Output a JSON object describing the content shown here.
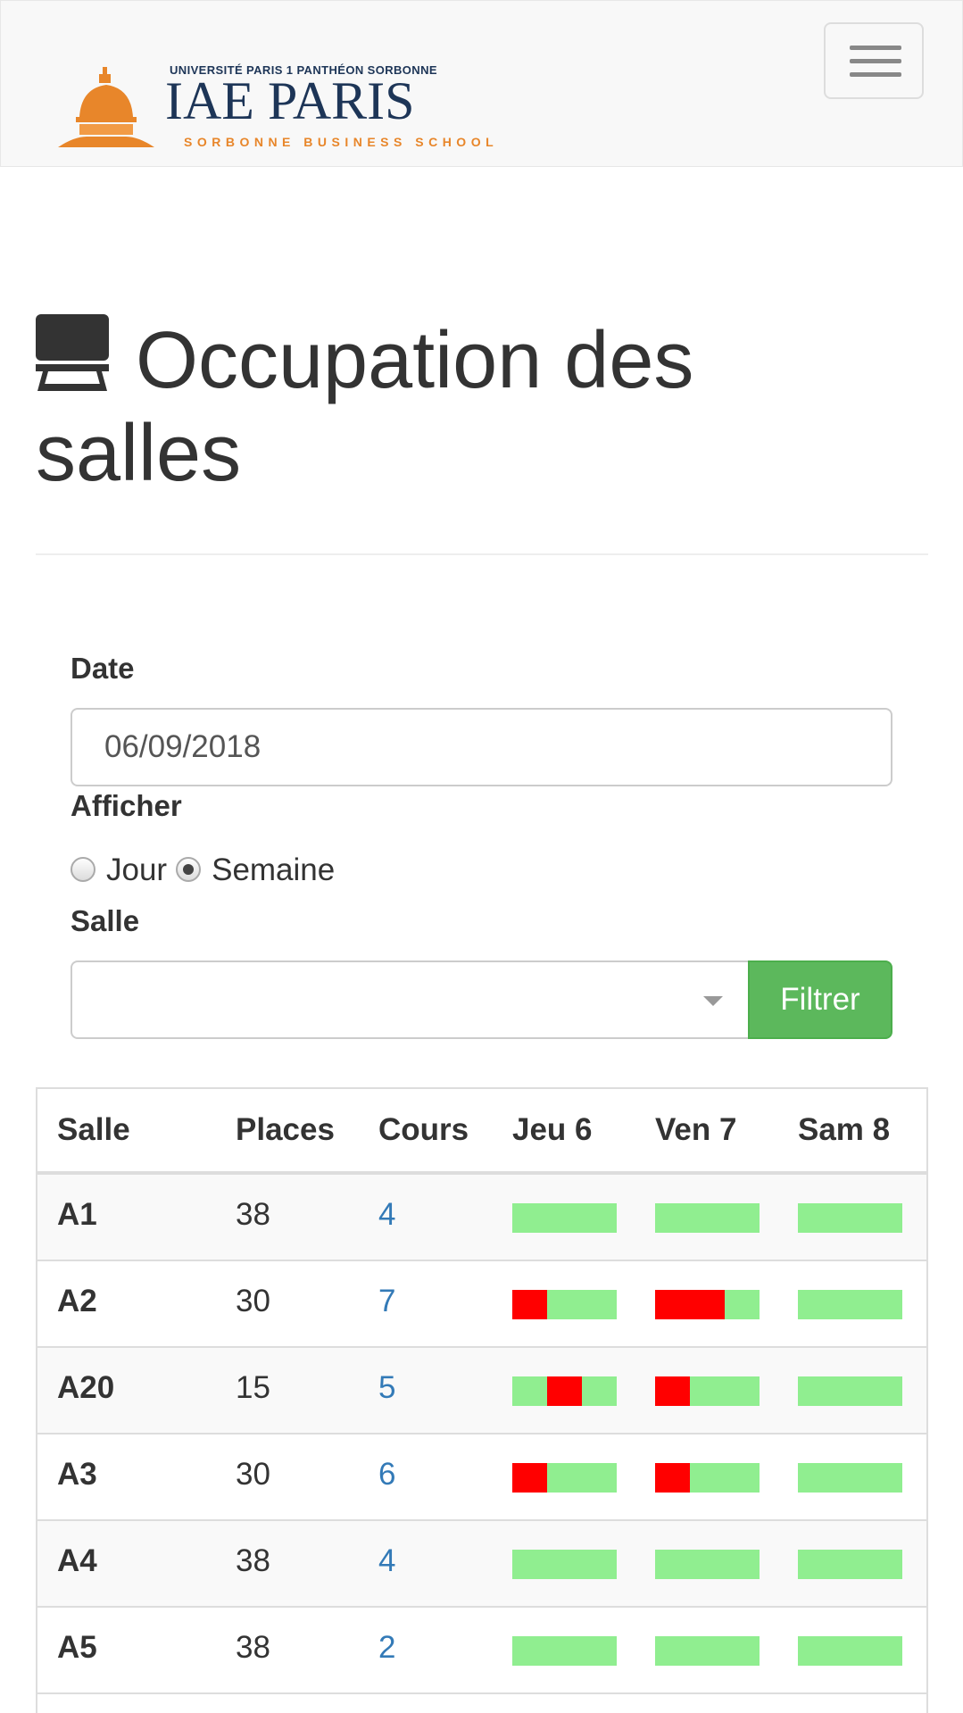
{
  "header": {
    "logo_small_text": "UNIVERSITÉ PARIS 1 PANTHÉON SORBONNE",
    "logo_main_text": "IAE PARIS",
    "logo_sub_text": "SORBONNE BUSINESS SCHOOL",
    "menu_icon": "hamburger-menu-icon"
  },
  "page": {
    "title": "Occupation des salles",
    "title_icon": "classroom-desk-icon"
  },
  "form": {
    "date_label": "Date",
    "date_value": "06/09/2018",
    "afficher_label": "Afficher",
    "options": [
      {
        "label": "Jour",
        "checked": false
      },
      {
        "label": "Semaine",
        "checked": true
      }
    ],
    "salle_label": "Salle",
    "salle_value": "",
    "filter_button": "Filtrer"
  },
  "table": {
    "headers": [
      "Salle",
      "Places",
      "Cours",
      "Jeu 6",
      "Ven 7",
      "Sam 8"
    ],
    "rows": [
      {
        "salle": "A1",
        "places": "38",
        "cours": "4",
        "occupancy": [
          [
            0,
            0,
            0
          ],
          [
            0,
            0,
            0
          ],
          [
            0,
            0,
            0
          ]
        ]
      },
      {
        "salle": "A2",
        "places": "30",
        "cours": "7",
        "occupancy": [
          [
            1,
            0,
            0
          ],
          [
            1,
            1,
            0
          ],
          [
            0,
            0,
            0
          ]
        ]
      },
      {
        "salle": "A20",
        "places": "15",
        "cours": "5",
        "occupancy": [
          [
            0,
            1,
            0
          ],
          [
            1,
            0,
            0
          ],
          [
            0,
            0,
            0
          ]
        ]
      },
      {
        "salle": "A3",
        "places": "30",
        "cours": "6",
        "occupancy": [
          [
            1,
            0,
            0
          ],
          [
            1,
            0,
            0
          ],
          [
            0,
            0,
            0
          ]
        ]
      },
      {
        "salle": "A4",
        "places": "38",
        "cours": "4",
        "occupancy": [
          [
            0,
            0,
            0
          ],
          [
            0,
            0,
            0
          ],
          [
            0,
            0,
            0
          ]
        ]
      },
      {
        "salle": "A5",
        "places": "38",
        "cours": "2",
        "occupancy": [
          [
            0,
            0,
            0
          ],
          [
            0,
            0,
            0
          ],
          [
            0,
            0,
            0
          ]
        ]
      }
    ]
  },
  "colors": {
    "free": "#90ee90",
    "busy": "#ff0000",
    "link": "#337ab7",
    "button": "#5cb85c"
  }
}
